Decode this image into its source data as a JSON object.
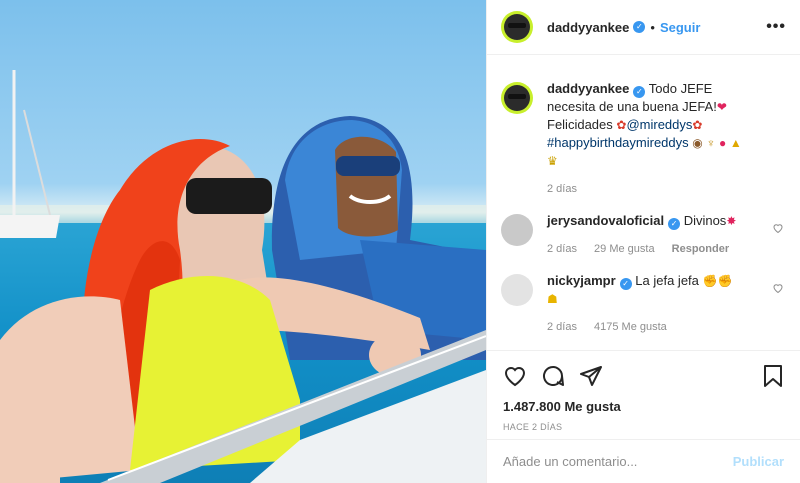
{
  "header": {
    "username": "daddyyankee",
    "separator": "•",
    "follow_label": "Seguir",
    "more_label": "•••"
  },
  "caption": {
    "username": "daddyyankee",
    "text_1": "Todo JEFE necesita de una buena JEFA!",
    "text_2": "Felicidades",
    "mention": "@mireddys",
    "hashtag": "#happybirthdaymireddys",
    "time": "2 días"
  },
  "comments": [
    {
      "username": "jerysandovaloficial",
      "text": "Divinos",
      "time": "2 días",
      "likes": "29 Me gusta",
      "reply": "Responder"
    },
    {
      "username": "nickyjampr",
      "text": "La jefa jefa",
      "time": "2 días",
      "likes": "4175 Me gusta"
    }
  ],
  "actions": {
    "likes": "1.487.800 Me gusta",
    "date": "HACE 2 DÍAS"
  },
  "add_comment": {
    "placeholder": "Añade un comentario...",
    "publish_label": "Publicar"
  },
  "icons": [
    "verified-badge",
    "heart-icon",
    "comment-icon",
    "share-icon",
    "bookmark-icon",
    "more-options-icon"
  ],
  "colors": {
    "accent": "#3897f0",
    "publish_disabled": "#b2dffc",
    "avatar_ring": "#c8ef2c"
  }
}
